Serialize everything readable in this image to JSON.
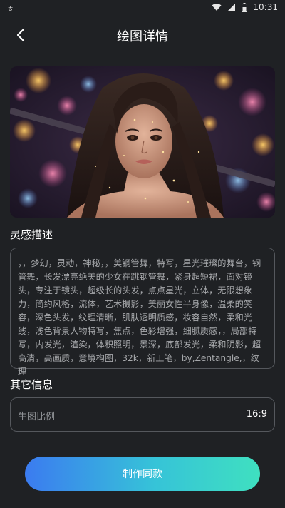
{
  "status_bar": {
    "left_text": "ㅎ",
    "time": "10:31",
    "icons": [
      "wifi-icon",
      "signal-icon",
      "battery-icon"
    ]
  },
  "header": {
    "title": "绘图详情",
    "back_icon": "chevron-left-icon"
  },
  "hero": {
    "image_desc_icon": "portrait-image"
  },
  "inspiration": {
    "title": "灵感描述",
    "text": "，，梦幻，灵动，神秘，，美钢管舞，特写，星光璀璨的舞台，钢管舞，长发漂亮绝美的少女在跳钢管舞，紧身超短裙，面对镜头，专注于镜头，超级长的头发，点点星光，立体，无限想象力，简约风格，流体，艺术摄影，美丽女性半身像，温柔的笑容，深色头发，纹理清晰，肌肤透明质感，妆容自然，柔和光线，浅色背景人物特写，焦点，色彩增强，细腻质感，，局部特写，内发光，渲染，体积照明，景深，底部发光，柔和阴影，超高清，高画质，意境构图，32k，新工笔，by,Zentangle,，纹理"
  },
  "other_info": {
    "title": "其它信息",
    "ratio_label": "生图比例",
    "ratio_value": "16:9"
  },
  "action": {
    "make_same_label": "制作同款"
  },
  "colors": {
    "background": "#1f2124",
    "border": "#55585d",
    "button_gradient_start": "#3b7bf0",
    "button_gradient_end": "#3fe0c0"
  }
}
